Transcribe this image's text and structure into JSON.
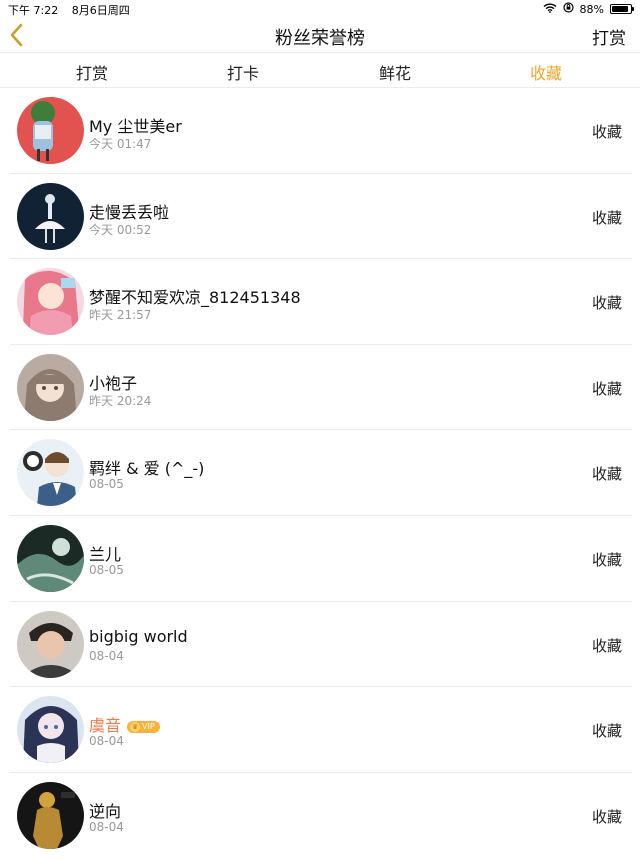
{
  "status_bar": {
    "time": "下午 7:22",
    "date": "8月6日周四",
    "battery": "88%",
    "battery_level": 0.88
  },
  "nav": {
    "back_icon": "chevron-left-icon",
    "title": "粉丝荣誉榜",
    "right_label": "打赏",
    "accent_color": "#f2a428"
  },
  "tabs": [
    {
      "label": "打赏",
      "active": false
    },
    {
      "label": "打卡",
      "active": false
    },
    {
      "label": "鲜花",
      "active": false
    },
    {
      "label": "收藏",
      "active": true
    }
  ],
  "list": [
    {
      "name": "My 尘世美er",
      "time": "今天 01:47",
      "action": "收藏"
    },
    {
      "name": "走慢丢丢啦",
      "time": "今天 00:52",
      "action": "收藏"
    },
    {
      "name": "梦醒不知爱欢凉_812451348",
      "time": "昨天 21:57",
      "action": "收藏"
    },
    {
      "name": "小袍子",
      "time": "昨天 20:24",
      "action": "收藏"
    },
    {
      "name": "羁绊 & 爱 (^_-)",
      "time": "08-05",
      "action": "收藏"
    },
    {
      "name": "兰儿",
      "time": "08-05",
      "action": "收藏"
    },
    {
      "name": "bigbig world",
      "time": "08-04",
      "action": "收藏"
    },
    {
      "name": "虞音",
      "time": "08-04",
      "action": "收藏",
      "vip": true,
      "vip_label": "VIP"
    },
    {
      "name": "逆向",
      "time": "08-04",
      "action": "收藏"
    }
  ]
}
